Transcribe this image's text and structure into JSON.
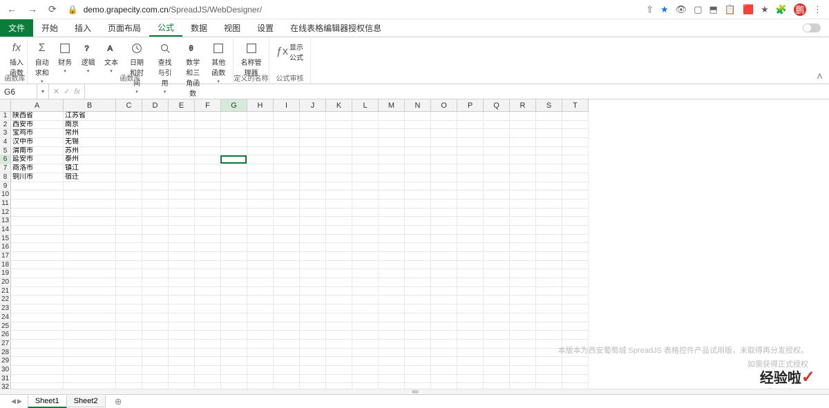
{
  "browser": {
    "url_domain": "demo.grapecity.com.cn",
    "url_path": "/SpreadJS/WebDesigner/",
    "avatar_text": "鹏"
  },
  "ribbon": {
    "tabs": {
      "file": "文件",
      "start": "开始",
      "insert": "插入",
      "layout": "页面布局",
      "formula": "公式",
      "data": "数据",
      "view": "视图",
      "settings": "设置",
      "license": "在线表格编辑器授权信息"
    },
    "groups": {
      "insert_fn": {
        "insert_function": "插入函数",
        "label": "函数库"
      },
      "functions": {
        "autosum": "自动求和",
        "finance": "财务",
        "logic": "逻辑",
        "text": "文本",
        "datetime": "日期和时间",
        "lookup": "查找与引用",
        "math": "数学和三角函数",
        "other": "其他函数",
        "label2": "函数库"
      },
      "names": {
        "name_manager": "名称管理器",
        "label": "定义的名称"
      },
      "audit": {
        "show_formula": "显示公式",
        "label": "公式审核"
      }
    }
  },
  "namebox": {
    "value": "G6"
  },
  "sheet_data": {
    "cols": [
      "A",
      "B",
      "C",
      "D",
      "E",
      "F",
      "G",
      "H",
      "I",
      "J",
      "K",
      "L",
      "M",
      "N",
      "O",
      "P",
      "Q",
      "R",
      "S",
      "T"
    ],
    "rows": [
      {
        "A": "陕西省",
        "B": "江苏省"
      },
      {
        "A": "西安市",
        "B": "南京"
      },
      {
        "A": "宝鸡市",
        "B": "常州"
      },
      {
        "A": "汉中市",
        "B": "无锡"
      },
      {
        "A": "渭南市",
        "B": "苏州"
      },
      {
        "A": "延安市",
        "B": "泰州"
      },
      {
        "A": "商洛市",
        "B": "镇江"
      },
      {
        "A": "铜川市",
        "B": "宿迁"
      }
    ],
    "row_count": 33,
    "active_cell": "G6"
  },
  "watermark": {
    "line1": "本版本为西安葡萄城 SpreadJS 表格控件产品试用版，未取得再分发授权。",
    "line2": "如需获得正式授权"
  },
  "logo": {
    "main": "经验啦",
    "sub": "jingyanla.com"
  },
  "tabs": {
    "sheet1": "Sheet1",
    "sheet2": "Sheet2"
  }
}
